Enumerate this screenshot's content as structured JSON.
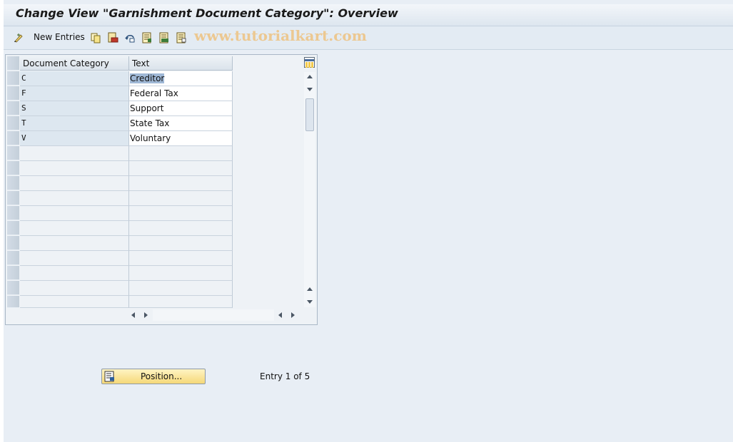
{
  "window": {
    "title": "Change View \"Garnishment Document Category\": Overview"
  },
  "toolbar": {
    "new_entries_label": "New Entries",
    "watermark": "www.tutorialkart.com"
  },
  "table": {
    "columns": [
      "Document Category",
      "Text"
    ],
    "rows": [
      {
        "category": "C",
        "text": "Creditor"
      },
      {
        "category": "F",
        "text": "Federal Tax"
      },
      {
        "category": "S",
        "text": "Support"
      },
      {
        "category": "T",
        "text": "State Tax"
      },
      {
        "category": "V",
        "text": "Voluntary"
      }
    ],
    "selected_cell": "Creditor"
  },
  "footer": {
    "position_label": "Position...",
    "entry_info": "Entry 1 of 5"
  }
}
